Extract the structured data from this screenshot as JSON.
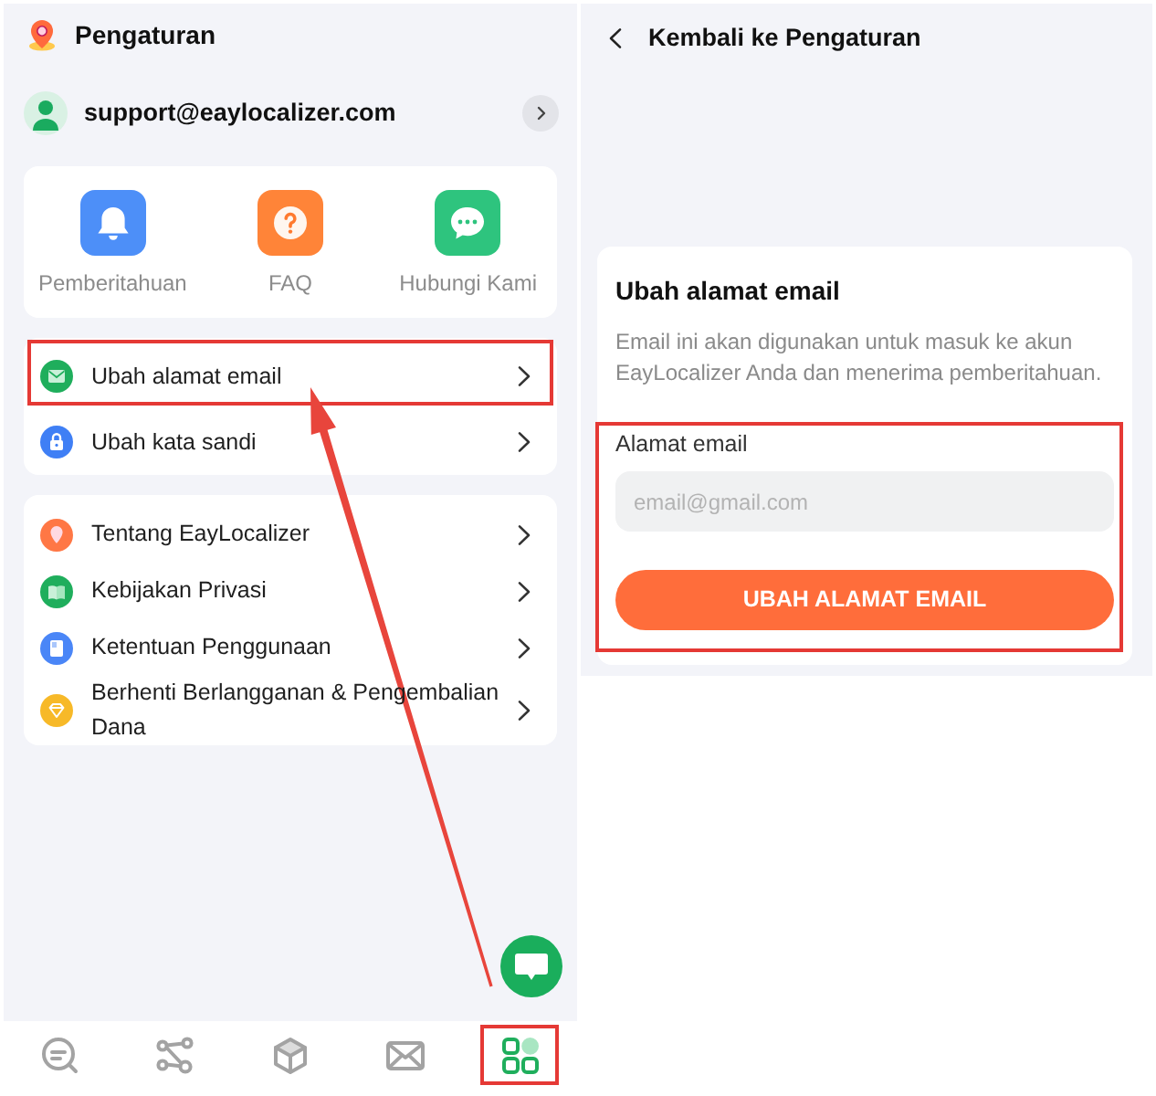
{
  "settings_screen": {
    "title": "Pengaturan",
    "account": {
      "email": "support@eaylocalizer.com"
    },
    "shortcuts": [
      {
        "kind": "bell",
        "label": "Pemberitahuan"
      },
      {
        "kind": "question",
        "label": "FAQ"
      },
      {
        "kind": "chat",
        "label": "Hubungi Kami"
      }
    ],
    "account_menu": [
      {
        "kind": "envelope",
        "label": "Ubah alamat email",
        "highlighted": true
      },
      {
        "kind": "lock",
        "label": "Ubah kata sandi",
        "highlighted": false
      }
    ],
    "info_menu": [
      {
        "kind": "pin",
        "label": "Tentang EayLocalizer",
        "highlighted": false
      },
      {
        "kind": "book",
        "label": "Kebijakan Privasi",
        "highlighted": false
      },
      {
        "kind": "document",
        "label": "Ketentuan Penggunaan",
        "highlighted": false
      },
      {
        "kind": "diamond",
        "label": "Berhenti Berlangganan & Pengembalian Dana",
        "highlighted": false
      }
    ],
    "bottom_nav": [
      {
        "kind": "search",
        "selected": false,
        "highlighted": false
      },
      {
        "kind": "nodes",
        "selected": false,
        "highlighted": false
      },
      {
        "kind": "cube",
        "selected": false,
        "highlighted": false
      },
      {
        "kind": "envelope",
        "selected": false,
        "highlighted": false
      },
      {
        "kind": "grid",
        "selected": true,
        "highlighted": true
      }
    ]
  },
  "email_screen": {
    "back_label": "Kembali ke Pengaturan",
    "title": "Ubah alamat email",
    "description": "Email ini akan digunakan untuk masuk ke akun EayLocalizer Anda dan menerima pemberitahuan.",
    "form": {
      "highlighted": true,
      "label": "Alamat email",
      "placeholder": "email@gmail.com",
      "button": "UBAH ALAMAT EMAIL"
    }
  },
  "pointer_arrow": true
}
